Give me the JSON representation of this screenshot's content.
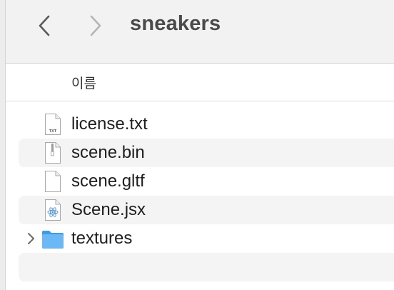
{
  "window": {
    "title": "sneakers"
  },
  "toolbar": {
    "back_icon": "chevron-left-icon",
    "forward_icon": "chevron-right-icon"
  },
  "columns": {
    "name_header": "이름"
  },
  "files": [
    {
      "name": "license.txt",
      "icon": "text-file-icon",
      "badge": "TXT"
    },
    {
      "name": "scene.bin",
      "icon": "archive-file-icon"
    },
    {
      "name": "scene.gltf",
      "icon": "blank-file-icon"
    },
    {
      "name": "Scene.jsx",
      "icon": "react-file-icon"
    },
    {
      "name": "textures",
      "icon": "folder-icon",
      "expandable": true
    }
  ],
  "colors": {
    "folder": "#5aaef0",
    "toolbar_bg": "#f2f2f2",
    "row_alt_bg": "#f4f4f4"
  }
}
